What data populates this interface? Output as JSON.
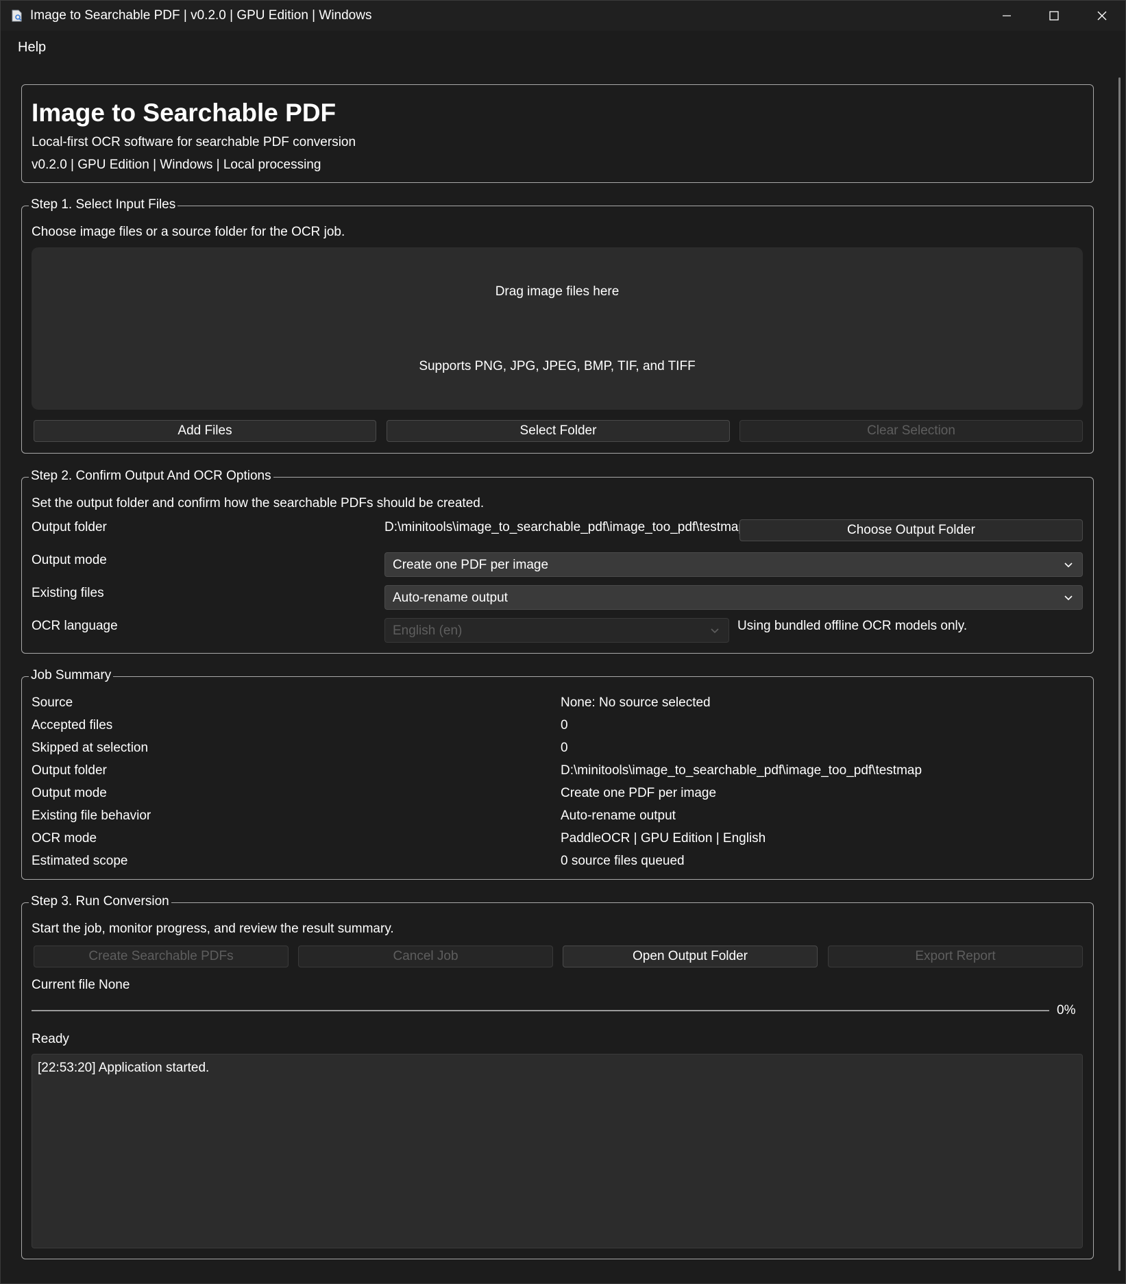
{
  "window": {
    "title": "Image to Searchable PDF | v0.2.0 | GPU Edition | Windows",
    "icon": "document-search-icon"
  },
  "menu": {
    "help": "Help"
  },
  "header": {
    "title": "Image to Searchable PDF",
    "subtitle": "Local-first OCR software for searchable PDF conversion",
    "version_line": "v0.2.0 | GPU Edition | Windows | Local processing"
  },
  "step1": {
    "title": "Step 1. Select Input Files",
    "description": "Choose image files or a source folder for the OCR job.",
    "dropzone_text": "Drag image files here",
    "dropzone_hint": "Supports PNG, JPG, JPEG, BMP, TIF, and TIFF",
    "add_files": "Add Files",
    "select_folder": "Select Folder",
    "clear_selection": "Clear Selection"
  },
  "step2": {
    "title": "Step 2. Confirm Output And OCR Options",
    "description": "Set the output folder and confirm how the searchable PDFs should be created.",
    "output_folder_label": "Output folder",
    "output_folder_value": "D:\\minitools\\image_to_searchable_pdf\\image_too_pdf\\testmap",
    "choose_output_folder": "Choose Output Folder",
    "output_mode_label": "Output mode",
    "output_mode_value": "Create one PDF per image",
    "existing_files_label": "Existing files",
    "existing_files_value": "Auto-rename output",
    "ocr_language_label": "OCR language",
    "ocr_language_value": "English (en)",
    "ocr_language_note": "Using bundled offline OCR models only."
  },
  "summary": {
    "title": "Job Summary",
    "rows": [
      {
        "label": "Source",
        "value": "None: No source selected"
      },
      {
        "label": "Accepted files",
        "value": "0"
      },
      {
        "label": "Skipped at selection",
        "value": "0"
      },
      {
        "label": "Output folder",
        "value": "D:\\minitools\\image_to_searchable_pdf\\image_too_pdf\\testmap"
      },
      {
        "label": "Output mode",
        "value": "Create one PDF per image"
      },
      {
        "label": "Existing file behavior",
        "value": "Auto-rename output"
      },
      {
        "label": "OCR mode",
        "value": "PaddleOCR | GPU Edition | English"
      },
      {
        "label": "Estimated scope",
        "value": "0 source files queued"
      }
    ]
  },
  "step3": {
    "title": "Step 3. Run Conversion",
    "description": "Start the job, monitor progress, and review the result summary.",
    "create_pdfs": "Create Searchable PDFs",
    "cancel_job": "Cancel Job",
    "open_output_folder": "Open Output Folder",
    "export_report": "Export Report",
    "current_file_label": "Current file",
    "current_file_value": "None",
    "progress_value": 0,
    "progress_text": "0%",
    "status": "Ready",
    "log": [
      "[22:53:20] Application started."
    ]
  }
}
